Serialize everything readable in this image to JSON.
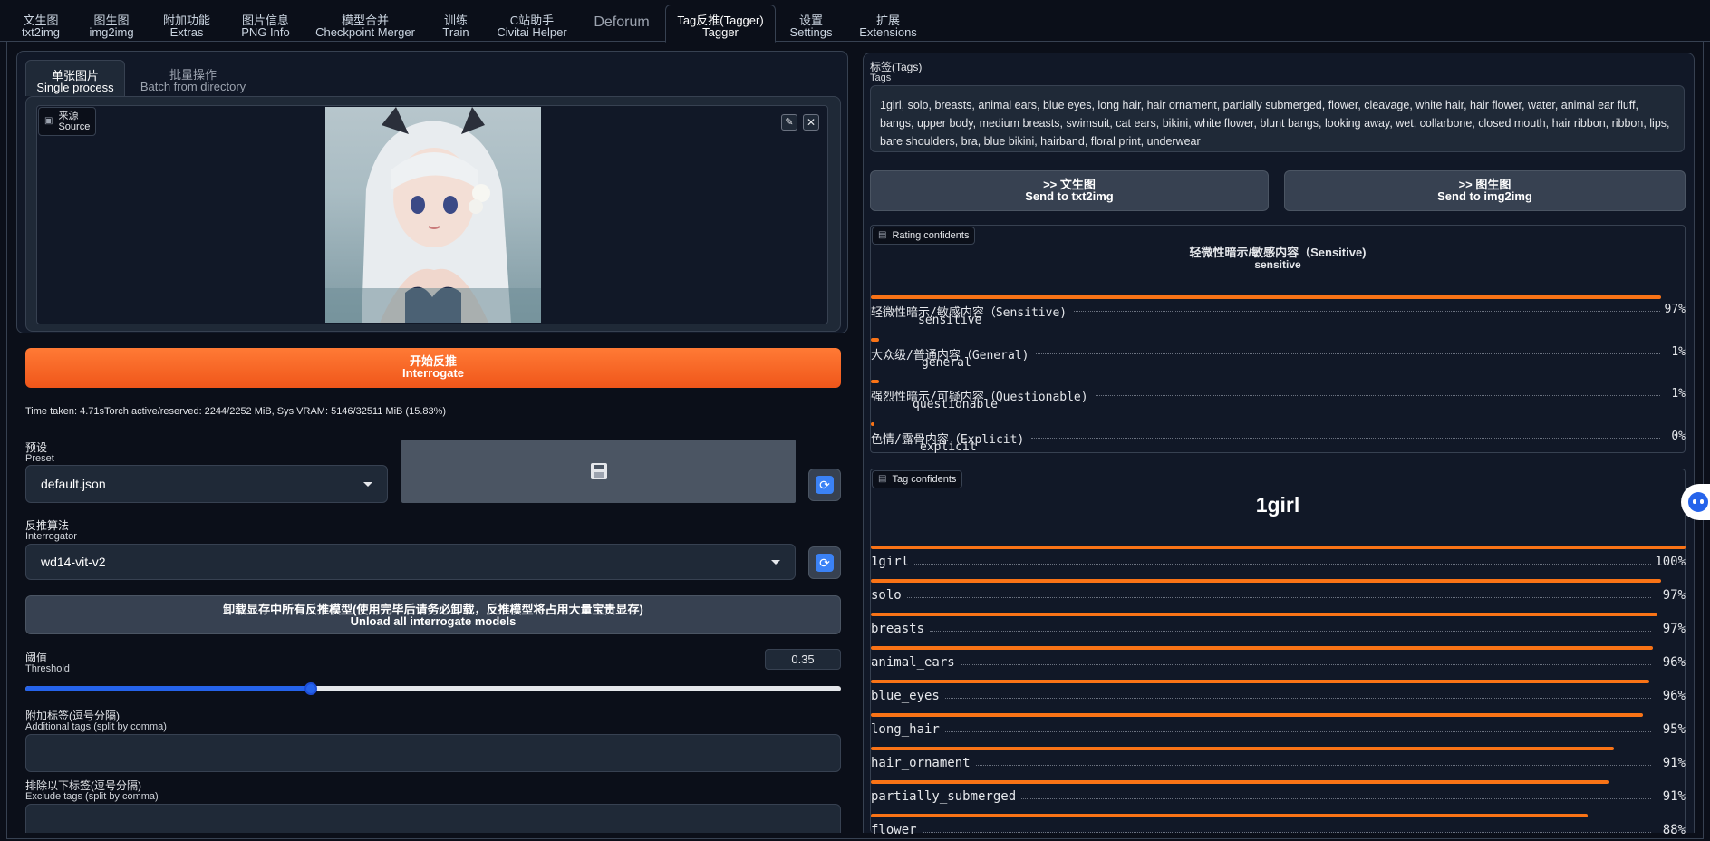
{
  "tabs": [
    {
      "zh": "文生图",
      "en": "txt2img"
    },
    {
      "zh": "图生图",
      "en": "img2img"
    },
    {
      "zh": "附加功能",
      "en": "Extras"
    },
    {
      "zh": "图片信息",
      "en": "PNG Info"
    },
    {
      "zh": "模型合并",
      "en": "Checkpoint Merger"
    },
    {
      "zh": "训练",
      "en": "Train"
    },
    {
      "zh": "C站助手",
      "en": "Civitai Helper"
    },
    {
      "zh": "Deforum",
      "en": ""
    },
    {
      "zh": "Tag反推(Tagger)",
      "en": "Tagger"
    },
    {
      "zh": "设置",
      "en": "Settings"
    },
    {
      "zh": "扩展",
      "en": "Extensions"
    }
  ],
  "subtabs": [
    {
      "zh": "单张图片",
      "en": "Single process"
    },
    {
      "zh": "批量操作",
      "en": "Batch from directory"
    }
  ],
  "source": {
    "zh": "来源",
    "en": "Source"
  },
  "interrogate": {
    "zh": "开始反推",
    "en": "Interrogate"
  },
  "time_taken": "Time taken: 4.71sTorch active/reserved: 2244/2252 MiB, Sys VRAM: 5146/32511 MiB (15.83%)",
  "preset": {
    "zh": "预设",
    "en": "Preset",
    "value": "default.json"
  },
  "interrogator": {
    "zh": "反推算法",
    "en": "Interrogator",
    "value": "wd14-vit-v2"
  },
  "unload": {
    "zh": "卸载显存中所有反推模型(使用完毕后请务必卸载，反推模型将占用大量宝贵显存)",
    "en": "Unload all interrogate models"
  },
  "threshold": {
    "zh": "阈值",
    "en": "Threshold",
    "value": "0.35",
    "fraction": 0.35
  },
  "additional": {
    "zh": "附加标签(逗号分隔)",
    "en": "Additional tags (split by comma)"
  },
  "exclude": {
    "zh": "排除以下标签(逗号分隔)",
    "en": "Exclude tags (split by comma)"
  },
  "tags_box": {
    "zh": "标签(Tags)",
    "en": "Tags",
    "text": "1girl, solo, breasts, animal ears, blue eyes, long hair, hair ornament, partially submerged, flower, cleavage, white hair, hair flower, water, animal ear fluff, bangs, upper body, medium breasts, swimsuit, cat ears, bikini, white flower, blunt bangs, looking away, wet, collarbone, closed mouth, hair ribbon, ribbon, lips, bare shoulders, bra, blue bikini, hairband, floral print, underwear"
  },
  "send_txt2img": {
    "zh": ">> 文生图",
    "en": "Send to txt2img"
  },
  "send_img2img": {
    "zh": ">> 图生图",
    "en": "Send to img2img"
  },
  "rating": {
    "label": "Rating confidents",
    "top_zh": "轻微性暗示/敏感内容（Sensitive)",
    "top_en": "sensitive",
    "items": [
      {
        "zh": "轻微性暗示/敏感内容（Sensitive)",
        "en": "sensitive",
        "pct": "97%",
        "value": 0.97
      },
      {
        "zh": "大众级/普通内容（General)",
        "en": "general",
        "pct": "1%",
        "value": 0.01
      },
      {
        "zh": "强烈性暗示/可疑内容（Questionable)",
        "en": "questionable",
        "pct": "1%",
        "value": 0.01
      },
      {
        "zh": "色情/露骨内容（Explicit)",
        "en": "explicit",
        "pct": "0%",
        "value": 0.0
      }
    ]
  },
  "tag_conf": {
    "label": "Tag confidents",
    "top": "1girl",
    "items": [
      {
        "name": "1girl",
        "pct": "100%",
        "value": 1.0
      },
      {
        "name": "solo",
        "pct": "97%",
        "value": 0.97
      },
      {
        "name": "breasts",
        "pct": "97%",
        "value": 0.965
      },
      {
        "name": "animal_ears",
        "pct": "96%",
        "value": 0.96
      },
      {
        "name": "blue_eyes",
        "pct": "96%",
        "value": 0.955
      },
      {
        "name": "long_hair",
        "pct": "95%",
        "value": 0.948
      },
      {
        "name": "hair_ornament",
        "pct": "91%",
        "value": 0.912
      },
      {
        "name": "partially_submerged",
        "pct": "91%",
        "value": 0.906
      },
      {
        "name": "flower",
        "pct": "88%",
        "value": 0.88
      }
    ]
  },
  "colors": {
    "accent": "#f97316",
    "bg": "#0b0f19",
    "panel": "#111827",
    "slider": "#2563eb"
  }
}
